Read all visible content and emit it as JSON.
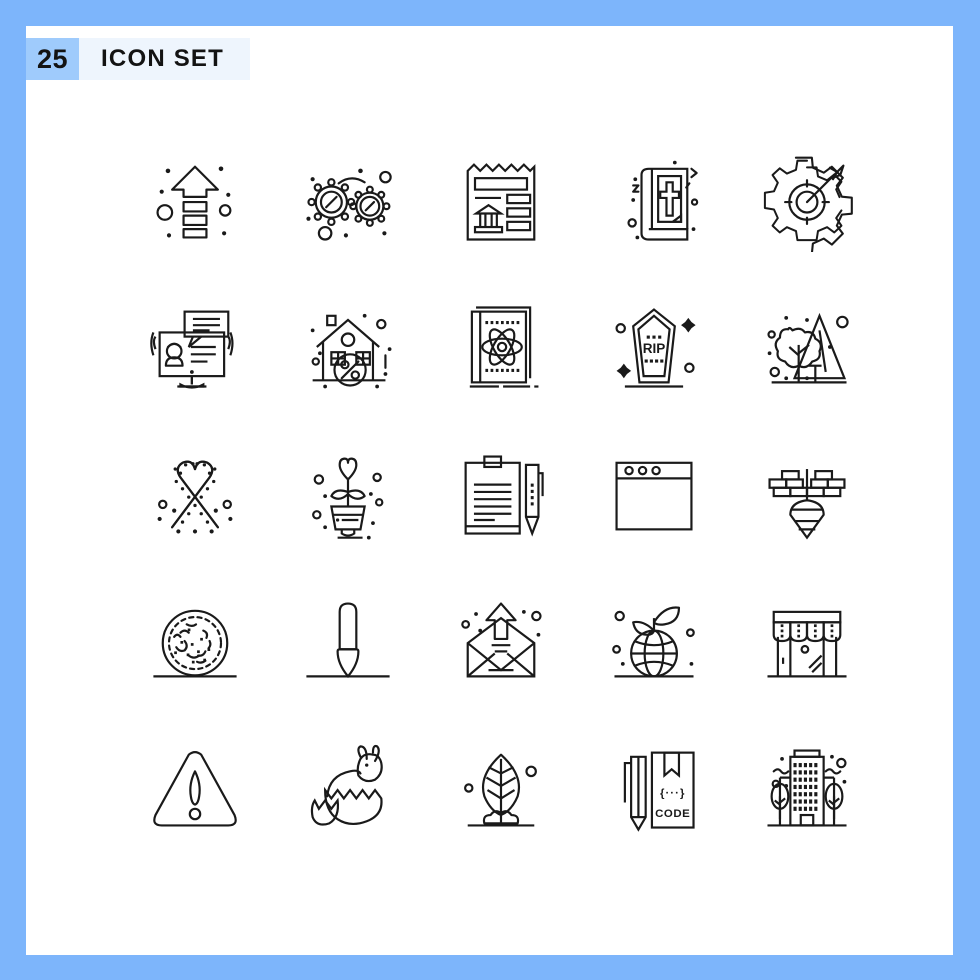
{
  "header": {
    "count_badge": "25",
    "title": "ICON SET",
    "badge_bg": "#9fcbfc",
    "title_bg": "#eef5fd",
    "text_color": "#131313"
  },
  "page": {
    "background_color": "#7db5fb",
    "panel_color": "#ffffff",
    "stroke_color": "#1a1a1a",
    "grid_columns": 5,
    "grid_rows": 5,
    "total_icons": 25
  },
  "icons": [
    {
      "index": 1,
      "name": "arrow-up-icon",
      "label": "Arrow Up",
      "row": 1,
      "col": 1
    },
    {
      "index": 2,
      "name": "gears-settings-icon",
      "label": "Gears",
      "row": 1,
      "col": 2
    },
    {
      "index": 3,
      "name": "bank-receipt-icon",
      "label": "Bank Receipt",
      "row": 1,
      "col": 3
    },
    {
      "index": 4,
      "name": "bible-book-icon",
      "label": "Bible",
      "row": 1,
      "col": 4
    },
    {
      "index": 5,
      "name": "gear-target-arrow-icon",
      "label": "Target Settings",
      "row": 1,
      "col": 5
    },
    {
      "index": 6,
      "name": "video-chat-monitor-icon",
      "label": "Online Support",
      "row": 2,
      "col": 1
    },
    {
      "index": 7,
      "name": "house-discount-icon",
      "label": "House Discount",
      "row": 2,
      "col": 2
    },
    {
      "index": 8,
      "name": "science-book-atom-icon",
      "label": "Science Book",
      "row": 2,
      "col": 3
    },
    {
      "index": 9,
      "name": "coffin-rip-icon",
      "label": "RIP Coffin",
      "row": 2,
      "col": 4
    },
    {
      "index": 10,
      "name": "tree-mountain-icon",
      "label": "Nature",
      "row": 2,
      "col": 5
    },
    {
      "index": 11,
      "name": "candy-canes-icon",
      "label": "Candy Canes",
      "row": 3,
      "col": 1
    },
    {
      "index": 12,
      "name": "heart-plant-pot-icon",
      "label": "Love Plant",
      "row": 3,
      "col": 2
    },
    {
      "index": 13,
      "name": "clipboard-pen-icon",
      "label": "Clipboard",
      "row": 3,
      "col": 3
    },
    {
      "index": 14,
      "name": "browser-window-icon",
      "label": "Browser Window",
      "row": 3,
      "col": 4
    },
    {
      "index": 15,
      "name": "plumb-bob-bricks-icon",
      "label": "Plumb Bob",
      "row": 3,
      "col": 5
    },
    {
      "index": 16,
      "name": "petri-dish-bacteria-icon",
      "label": "Bacteria",
      "row": 4,
      "col": 1
    },
    {
      "index": 17,
      "name": "paint-brush-icon",
      "label": "Paint Brush",
      "row": 4,
      "col": 2
    },
    {
      "index": 18,
      "name": "send-email-icon",
      "label": "Send Email",
      "row": 4,
      "col": 3
    },
    {
      "index": 19,
      "name": "eco-globe-icon",
      "label": "Eco Globe",
      "row": 4,
      "col": 4
    },
    {
      "index": 20,
      "name": "shop-storefront-icon",
      "label": "Shop",
      "row": 4,
      "col": 5
    },
    {
      "index": 21,
      "name": "warning-triangle-icon",
      "label": "Warning",
      "row": 5,
      "col": 1
    },
    {
      "index": 22,
      "name": "easter-bunny-egg-icon",
      "label": "Easter Bunny",
      "row": 5,
      "col": 2
    },
    {
      "index": 23,
      "name": "leaf-sprout-icon",
      "label": "Sprout",
      "row": 5,
      "col": 3
    },
    {
      "index": 24,
      "name": "code-book-pencil-icon",
      "label": "Code Book",
      "row": 5,
      "col": 4
    },
    {
      "index": 25,
      "name": "office-building-icon",
      "label": "Office Building",
      "row": 5,
      "col": 5
    }
  ],
  "icon_text": {
    "coffin_rip": "RIP",
    "code_book": "CODE",
    "house_percent": "%"
  }
}
